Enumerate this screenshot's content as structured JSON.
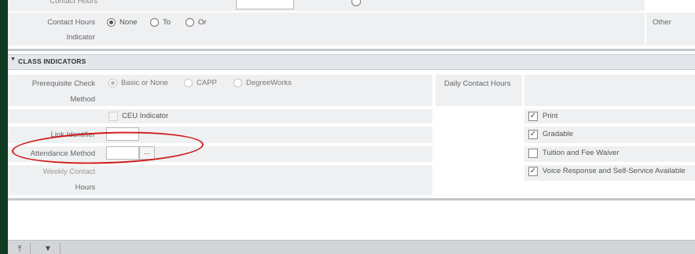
{
  "top_row": {
    "contact_hours_label": "Contact Hours",
    "indicator_label": "Indicator",
    "radio_options": [
      "None",
      "To",
      "Or"
    ],
    "selected": "None",
    "other_label": "Other"
  },
  "section": {
    "title": "CLASS INDICATORS",
    "collapse_icon": "caret-down-icon"
  },
  "class_indicators": {
    "prereq_label": "Prerequisite Check",
    "method_label": "Method",
    "prereq_options": [
      "Basic or None",
      "CAPP",
      "DegreeWorks"
    ],
    "prereq_selected": "Basic or None",
    "ceu_label": "CEU Indicator",
    "link_identifier_label": "Link Identifier",
    "link_identifier_value": "",
    "attendance_label": "Attendance Method",
    "attendance_value": "",
    "lookup_button_label": "...",
    "weekly_contact_label": "Weekly Contact",
    "hours_label": "Hours",
    "daily_contact_label": "Daily Contact Hours"
  },
  "right_checkboxes": [
    {
      "label": "Print",
      "checked": true
    },
    {
      "label": "Gradable",
      "checked": true
    },
    {
      "label": "Tuition and Fee Waiver",
      "checked": false
    },
    {
      "label": "Voice Response and Self-Service Available",
      "checked": true
    }
  ],
  "footer": {
    "icons": [
      "move-top-icon",
      "move-down-icon"
    ]
  },
  "annotation": {
    "color": "#d11a1a"
  }
}
